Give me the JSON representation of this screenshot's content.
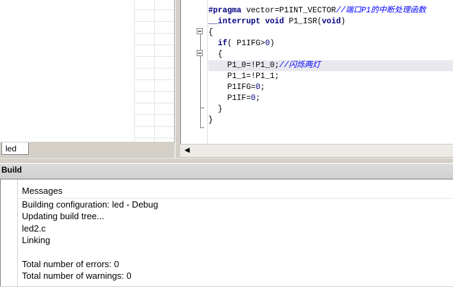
{
  "workspace": {
    "tab_label": "led"
  },
  "editor": {
    "code_lines": [
      [
        {
          "c": "pp",
          "t": "#pragma"
        },
        {
          "c": "",
          "t": " vector=P1INT_VECTOR"
        },
        {
          "c": "cm",
          "t": "//端口P1的中断处理函数"
        }
      ],
      [
        {
          "c": "kw",
          "t": "__interrupt"
        },
        {
          "c": "",
          "t": " "
        },
        {
          "c": "kw",
          "t": "void"
        },
        {
          "c": "",
          "t": " P1_ISR("
        },
        {
          "c": "kw",
          "t": "void"
        },
        {
          "c": "",
          "t": ")"
        }
      ],
      [
        {
          "c": "",
          "t": "{"
        }
      ],
      [
        {
          "c": "",
          "t": "  "
        },
        {
          "c": "kw",
          "t": "if"
        },
        {
          "c": "",
          "t": "( P1IFG>"
        },
        {
          "c": "num",
          "t": "0"
        },
        {
          "c": "",
          "t": ")"
        }
      ],
      [
        {
          "c": "",
          "t": "  {"
        }
      ],
      [
        {
          "c": "",
          "t": "    P1_0=!P1_0;"
        },
        {
          "c": "cm",
          "t": "//闪烁两灯"
        }
      ],
      [
        {
          "c": "",
          "t": "    P1_1=!P1_1;"
        }
      ],
      [
        {
          "c": "",
          "t": "    P1IFG="
        },
        {
          "c": "num",
          "t": "0"
        },
        {
          "c": "",
          "t": ";"
        }
      ],
      [
        {
          "c": "",
          "t": "    P1IF="
        },
        {
          "c": "num",
          "t": "0"
        },
        {
          "c": "",
          "t": ";"
        }
      ],
      [
        {
          "c": "",
          "t": "  }"
        }
      ],
      [
        {
          "c": "",
          "t": "}"
        }
      ]
    ],
    "current_line_index": 5,
    "scroll_left_icon": "scroll-left-arrow-icon"
  },
  "build": {
    "title": "Build",
    "header": "Messages",
    "messages": [
      "Building configuration: led - Debug",
      "Updating build tree...",
      "led2.c",
      "Linking",
      "",
      "Total number of errors: 0",
      "Total number of warnings: 0"
    ]
  },
  "colors": {
    "keyword": "#000080",
    "comment": "#0000ff",
    "chrome": "#d4d0c8"
  }
}
